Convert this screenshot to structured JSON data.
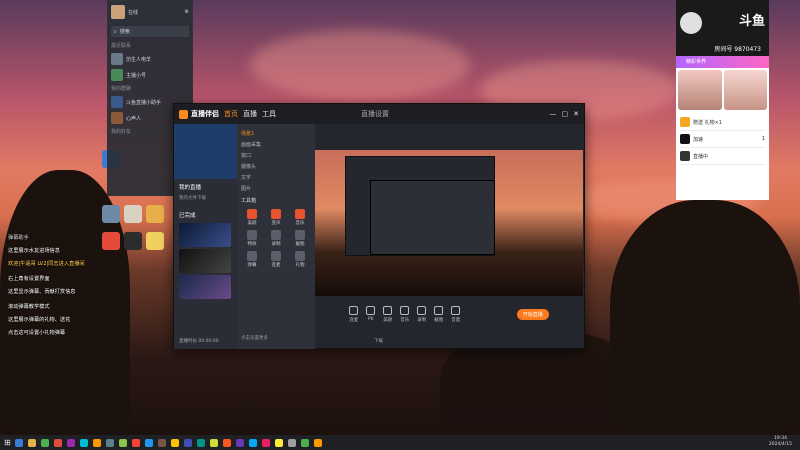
{
  "qq": {
    "status": "在线",
    "search_placeholder": "搜索",
    "section_recent": "最近联系",
    "section_groups": "我的群聊",
    "section_friends": "我的好友",
    "contacts": [
      {
        "name": "仿生人电羊",
        "sub": "ok"
      },
      {
        "name": "主播小号",
        "sub": "直播中"
      },
      {
        "name": "斗鱼直播小助手",
        "sub": ""
      },
      {
        "name": "心声人",
        "sub": ""
      }
    ]
  },
  "chat": {
    "header": "弹幕助手",
    "lines": [
      "这里展示水友进场信息",
      "欢迎|牛逼哥 LV2|同志进入直播间",
      "",
      "右上角有设置界面",
      "这里显示弹幕、贡献打赏信息",
      "",
      "滚动弹幕教学模式",
      "这里展示弹幕的礼物、送花",
      "点击这可设置小礼物弹幕"
    ]
  },
  "window": {
    "app_title": "直播伴侣",
    "nav": [
      "首页",
      "直播",
      "工具"
    ],
    "left_tab_label": "我的直播",
    "left_sub": "我的文件下载",
    "completed_label": "已完成",
    "thumbs": [
      "video-1",
      "video-2",
      "video-3"
    ],
    "toolbar_title": "直播设置",
    "menu_items": [
      "场景1",
      "画面采集",
      "窗口",
      "摄像头",
      "文字",
      "图片"
    ],
    "tool_section": "工具箱",
    "tools": [
      "美颜",
      "变声",
      "音乐",
      "特效",
      "录制",
      "截图",
      "弹幕",
      "连麦",
      "礼物"
    ],
    "bottom_hint": "点击设置更多",
    "controls": [
      "连麦",
      "PK",
      "美颜",
      "音乐",
      "录制",
      "截图",
      "音量"
    ],
    "go_live": "开始直播",
    "status_left": "直播时长 00:00:00",
    "status_mid": "下载"
  },
  "live_panel": {
    "brand": "斗鱼",
    "room_label": "房间号",
    "room_no": "9870473",
    "banner": "精彩世界",
    "gift_rows": [
      {
        "label": "赠送 礼物×1",
        "price": ""
      },
      {
        "label": "加速",
        "price": "1"
      },
      {
        "label": "直播中",
        "price": ""
      }
    ]
  },
  "taskbar": {
    "time": "19:34",
    "date": "2024/4/15"
  }
}
